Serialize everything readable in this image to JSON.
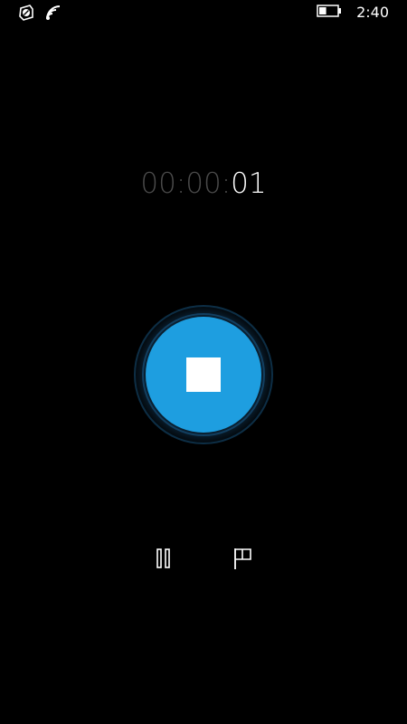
{
  "status_bar": {
    "icons": [
      "app-notification-icon",
      "wifi-icon",
      "battery-icon"
    ],
    "time": "2:40",
    "battery_level": 0.4
  },
  "timer": {
    "dim_part": "00:00:",
    "bright_part": "01"
  },
  "record_control": {
    "icon": "stop-icon",
    "accent_color": "#1e9ee0"
  },
  "controls": [
    {
      "icon": "pause-icon"
    },
    {
      "icon": "flag-icon"
    }
  ]
}
